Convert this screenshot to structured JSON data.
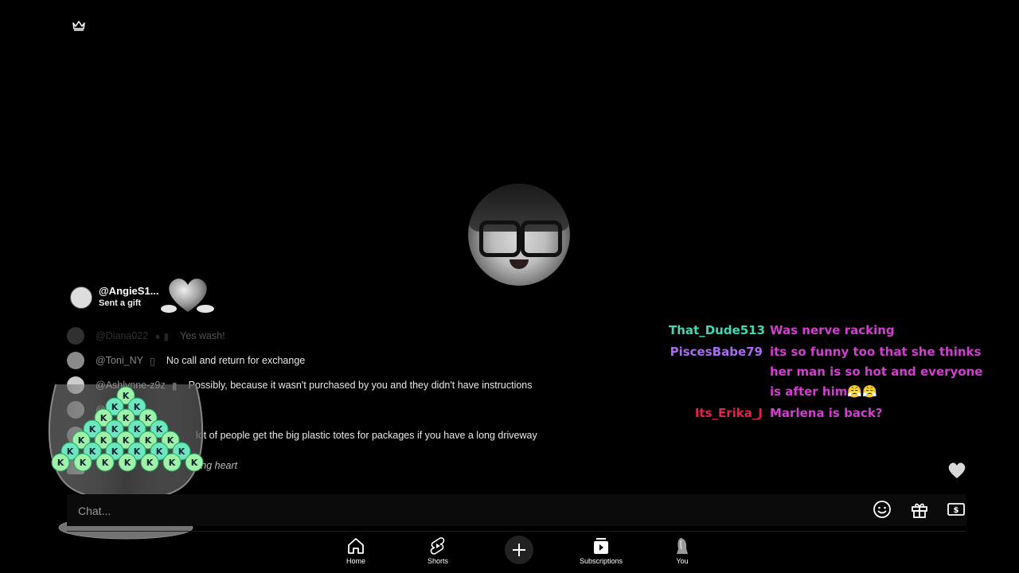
{
  "gift_notice": {
    "username": "@AngieS1...",
    "subtitle": "Sent a gift"
  },
  "left_chat": [
    {
      "name": "@Diana022",
      "text": "Yes wash!",
      "faded": true
    },
    {
      "name": "@Toni_NY",
      "text": "No call and return for exchange",
      "faded": false
    },
    {
      "name": "@Ashlynne-z9z",
      "text": "Possibly, because it wasn't purchased by you and they didn't have instructions",
      "faded": false
    },
    {
      "name": "@C",
      "text": "",
      "faded": false
    },
    {
      "name": "",
      "text": "lot of people get the big plastic totes for packages if you have a long driveway",
      "faded": false
    },
    {
      "name": "",
      "text": "ting heart",
      "faded": false
    }
  ],
  "right_chat": [
    {
      "name": "That_Dude513",
      "name_color": "#3fd9b4",
      "message": "Was nerve racking"
    },
    {
      "name": "PiscesBabe79",
      "name_color": "#a86bf0",
      "message": "its so funny too that she thinks her man is so hot and everyone is after him😤😤"
    },
    {
      "name": "Its_Erika_J",
      "name_color": "#e0234e",
      "message": "Marlena is back?"
    }
  ],
  "chat_input": {
    "placeholder": "Chat..."
  },
  "nav": {
    "home": "Home",
    "shorts": "Shorts",
    "subscriptions": "Subscriptions",
    "you": "You"
  },
  "icons": [
    "crown-icon",
    "emoji-icon",
    "gift-icon",
    "super-chat-icon",
    "heart-icon",
    "home-icon",
    "shorts-icon",
    "create-icon",
    "subscriptions-icon"
  ],
  "colors": {
    "message": "#d23fd0",
    "background": "#000000"
  }
}
